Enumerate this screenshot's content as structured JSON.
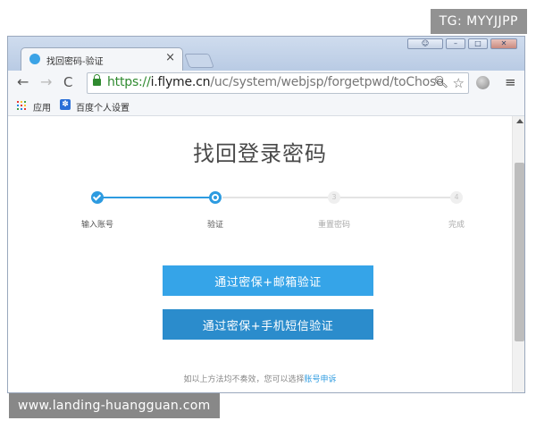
{
  "watermarks": {
    "top": "TG: MYYJJPP",
    "bottom": "www.landing-huangguan.com"
  },
  "browser": {
    "tab": {
      "title": "找回密码-验证",
      "close": "×"
    },
    "nav": {
      "back": "←",
      "forward": "→",
      "reload": "C"
    },
    "url": {
      "scheme": "https://",
      "host": "i.flyme.cn",
      "path": "/uc/system/webjsp/forgetpwd/toChose"
    },
    "bookmarks": {
      "apps_label": "应用",
      "baidu_label": "百度个人设置"
    }
  },
  "page": {
    "title": "找回登录密码",
    "steps": [
      {
        "label": "输入账号",
        "state": "done"
      },
      {
        "label": "验证",
        "state": "active"
      },
      {
        "label": "重置密码",
        "state": "todo",
        "num": "3"
      },
      {
        "label": "完成",
        "state": "todo",
        "num": "4"
      }
    ],
    "options": {
      "email": "通过密保+邮箱验证",
      "sms": "通过密保+手机短信验证"
    },
    "footer": {
      "text": "如以上方法均不奏效，您可以选择",
      "link": "账号申诉"
    }
  },
  "colors": {
    "accent": "#2d9be0",
    "button_primary": "#35a4e8",
    "button_secondary": "#2b8ccc"
  }
}
